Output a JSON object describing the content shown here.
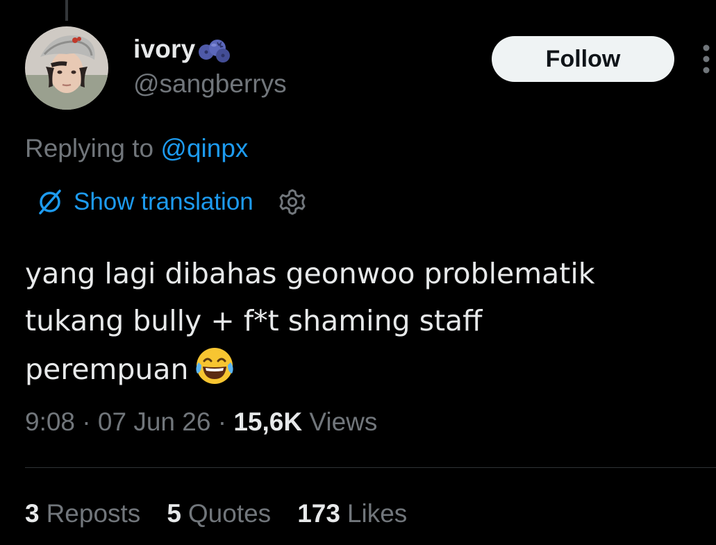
{
  "author": {
    "display_name": "ivory",
    "name_emoji": "blueberries-icon",
    "handle": "@sangberrys",
    "avatar": "avatar-photo"
  },
  "actions": {
    "follow_label": "Follow",
    "more_icon": "more-vertical-icon"
  },
  "reply": {
    "prefix": "Replying to",
    "mention": "@qinpx"
  },
  "translation": {
    "icon": "globe-slash-icon",
    "label": "Show translation",
    "settings_icon": "gear-icon"
  },
  "tweet": {
    "lines": [
      "yang lagi dibahas geonwoo problematik",
      "tukang bully + f*t shaming staff",
      "perempuan"
    ],
    "trailing_emoji": "face-with-tears-of-joy-icon"
  },
  "meta": {
    "time": "9:08",
    "separator": "·",
    "date": "07 Jun 26",
    "views_count": "15,6K",
    "views_label": "Views"
  },
  "stats": {
    "reposts": {
      "count": "3",
      "label": "Reposts"
    },
    "quotes": {
      "count": "5",
      "label": "Quotes"
    },
    "likes": {
      "count": "173",
      "label": "Likes"
    }
  },
  "colors": {
    "background": "#000000",
    "text_primary": "#e7e9ea",
    "text_secondary": "#71767b",
    "link": "#1d9bf0",
    "button_bg": "#eff3f4",
    "divider": "#2f3336"
  }
}
